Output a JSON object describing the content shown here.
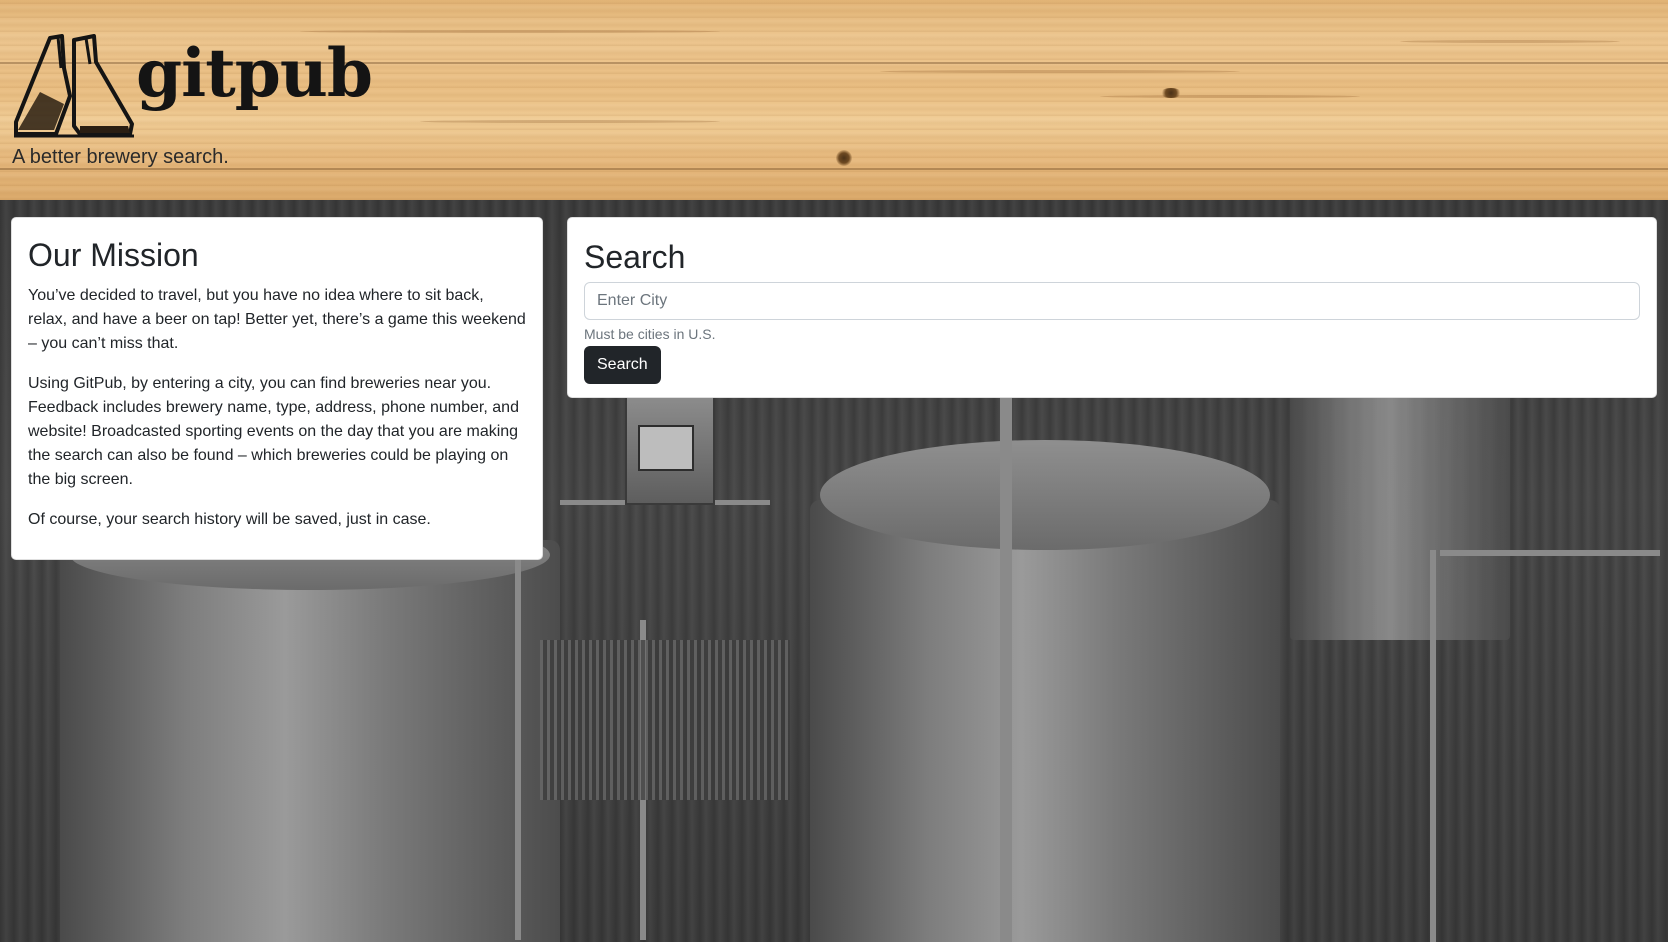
{
  "header": {
    "brand_name": "gitpub",
    "tagline": "A better brewery search."
  },
  "mission": {
    "title": "Our Mission",
    "paragraphs": [
      "You’ve decided to travel, but you have no idea where to sit back, relax, and have a beer on tap! Better yet, there’s a game this weekend – you can’t miss that.",
      "Using GitPub, by entering a city, you can find breweries near you. Feedback includes brewery name, type, address, phone number, and website! Broadcasted sporting events on the day that you are making the search can also be found – which breweries could be playing on the big screen.",
      "Of course, your search history will be saved, just in case."
    ]
  },
  "search": {
    "title": "Search",
    "input_placeholder": "Enter City",
    "input_value": "",
    "help_text": "Must be cities in U.S.",
    "button_label": "Search"
  },
  "icons": {
    "logo": "beer-glasses-icon"
  },
  "colors": {
    "button_bg": "#212529",
    "card_bg": "#ffffff",
    "text": "#212529",
    "muted": "#6c757d",
    "wood": "#e9bd81"
  }
}
